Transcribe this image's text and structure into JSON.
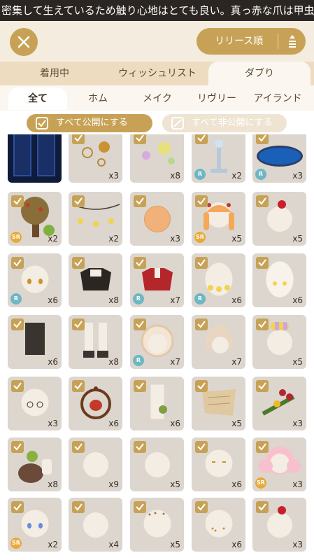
{
  "ticker": "密集して生えているため触り心地はとても良い。真っ赤な爪は甲虫の",
  "sort_label": "リリース順",
  "tabs1": [
    "着用中",
    "ウィッシュリスト",
    "ダブり"
  ],
  "tabs2": [
    "全て",
    "ホム",
    "メイク",
    "リヴリー",
    "アイランド"
  ],
  "public_label": "すべて公開にする",
  "private_label": "すべて非公開にする",
  "colors": {
    "accent": "#c7a256",
    "rarity_r": "#6db7c5",
    "rarity_sr": "#e8a93a"
  },
  "items": [
    {
      "type": "dark-panel",
      "checked": false,
      "qty": "",
      "rarity": ""
    },
    {
      "type": "ornaments-gold",
      "checked": true,
      "qty": "x3",
      "rarity": ""
    },
    {
      "type": "ornaments-pink",
      "checked": true,
      "qty": "x8",
      "rarity": ""
    },
    {
      "type": "fountain",
      "checked": true,
      "qty": "x2",
      "rarity": "R"
    },
    {
      "type": "pond",
      "checked": true,
      "qty": "x3",
      "rarity": "R"
    },
    {
      "type": "tree",
      "checked": true,
      "qty": "x2",
      "rarity": "SR"
    },
    {
      "type": "lights",
      "checked": true,
      "qty": "x2",
      "rarity": ""
    },
    {
      "type": "hair-orange",
      "checked": true,
      "qty": "x3",
      "rarity": ""
    },
    {
      "type": "hair-braids",
      "checked": true,
      "qty": "x5",
      "rarity": "SR"
    },
    {
      "type": "head-cherry",
      "checked": true,
      "qty": "x5",
      "rarity": ""
    },
    {
      "type": "head-eyes",
      "checked": true,
      "qty": "x6",
      "rarity": "R"
    },
    {
      "type": "top-black",
      "checked": true,
      "qty": "x8",
      "rarity": ""
    },
    {
      "type": "top-red",
      "checked": true,
      "qty": "x7",
      "rarity": "R"
    },
    {
      "type": "head-flowers",
      "checked": true,
      "qty": "x6",
      "rarity": "R"
    },
    {
      "type": "head-egg",
      "checked": true,
      "qty": "x6",
      "rarity": ""
    },
    {
      "type": "pants-black",
      "checked": true,
      "qty": "x6",
      "rarity": ""
    },
    {
      "type": "boots",
      "checked": true,
      "qty": "x8",
      "rarity": ""
    },
    {
      "type": "bonnet",
      "checked": true,
      "qty": "x7",
      "rarity": "R"
    },
    {
      "type": "hood",
      "checked": true,
      "qty": "x7",
      "rarity": ""
    },
    {
      "type": "head-bouquet",
      "checked": true,
      "qty": "x5",
      "rarity": ""
    },
    {
      "type": "head-glasses",
      "checked": true,
      "qty": "x3",
      "rarity": ""
    },
    {
      "type": "lantern",
      "checked": true,
      "qty": "x6",
      "rarity": ""
    },
    {
      "type": "suspenders",
      "checked": true,
      "qty": "x6",
      "rarity": ""
    },
    {
      "type": "scroll",
      "checked": true,
      "qty": "x5",
      "rarity": ""
    },
    {
      "type": "berries",
      "checked": true,
      "qty": "x3",
      "rarity": ""
    },
    {
      "type": "pot",
      "checked": true,
      "qty": "x8",
      "rarity": ""
    },
    {
      "type": "head-plain",
      "checked": true,
      "qty": "x9",
      "rarity": ""
    },
    {
      "type": "head-plain",
      "checked": true,
      "qty": "x5",
      "rarity": ""
    },
    {
      "type": "head-dots",
      "checked": true,
      "qty": "x6",
      "rarity": ""
    },
    {
      "type": "hair-pink",
      "checked": true,
      "qty": "x3",
      "rarity": "SR"
    },
    {
      "type": "head-blue-eyes",
      "checked": true,
      "qty": "x2",
      "rarity": "SR"
    },
    {
      "type": "head-plain",
      "checked": true,
      "qty": "x4",
      "rarity": ""
    },
    {
      "type": "head-freckles",
      "checked": true,
      "qty": "x5",
      "rarity": ""
    },
    {
      "type": "head-freckles2",
      "checked": true,
      "qty": "x6",
      "rarity": ""
    },
    {
      "type": "head-cherry2",
      "checked": true,
      "qty": "x3",
      "rarity": ""
    }
  ]
}
